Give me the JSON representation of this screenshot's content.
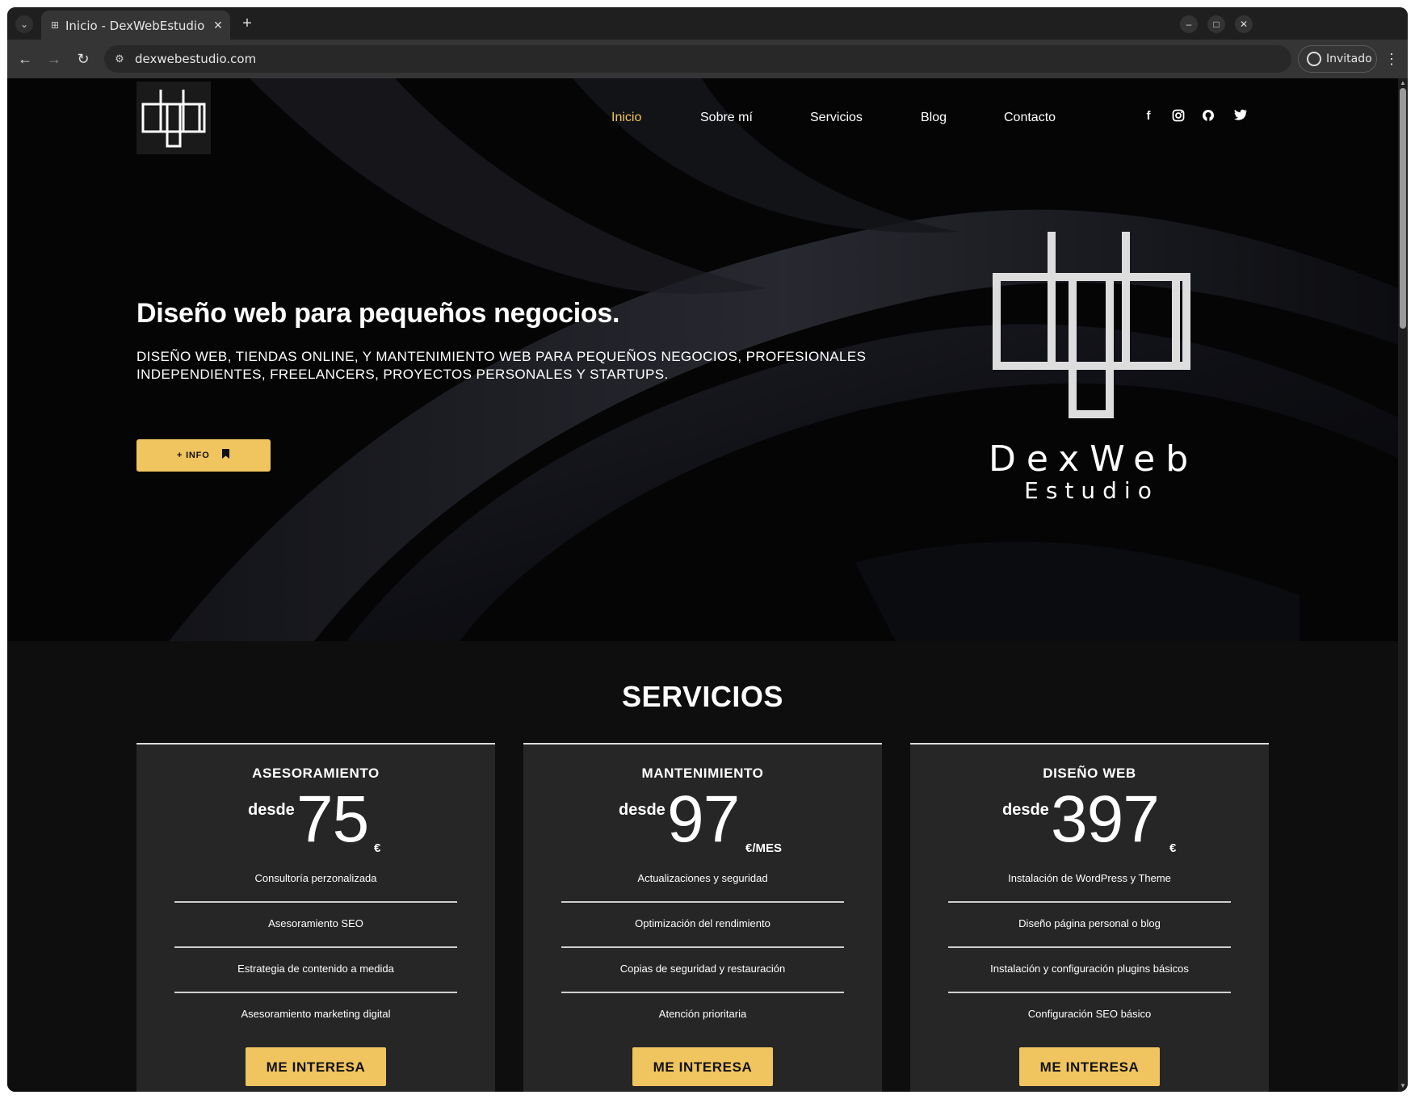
{
  "browser": {
    "tab_title": "Inicio - DexWebEstudio",
    "url": "dexwebestudio.com",
    "profile_label": "Invitado",
    "icons": {
      "tab_menu": "chevron-down-icon",
      "tab_favicon": "site-favicon-icon",
      "tab_close": "close-icon",
      "new_tab": "plus-icon",
      "minimize": "minimize-icon",
      "maximize": "maximize-icon",
      "close_window": "close-icon",
      "back": "back-arrow-icon",
      "forward": "forward-arrow-icon",
      "reload": "reload-icon",
      "site_settings": "tune-icon",
      "profile": "person-icon",
      "menu": "kebab-icon"
    }
  },
  "site": {
    "nav": [
      {
        "label": "Inicio",
        "active": true
      },
      {
        "label": "Sobre mí",
        "active": false
      },
      {
        "label": "Servicios",
        "active": false
      },
      {
        "label": "Blog",
        "active": false
      },
      {
        "label": "Contacto",
        "active": false
      }
    ],
    "social": [
      "facebook-icon",
      "instagram-icon",
      "github-icon",
      "twitter-icon"
    ],
    "hero": {
      "title": "Diseño web para pequeños negocios.",
      "subtitle": "DISEÑO WEB, TIENDAS ONLINE, Y MANTENIMIENTO WEB PARA PEQUEÑOS NEGOCIOS, PROFESIONALES INDEPENDIENTES, FREELANCERS, PROYECTOS PERSONALES Y STARTUPS.",
      "button_label": "+ INFO",
      "button_icon": "bookmark-icon",
      "brand_name": "DexWeb",
      "brand_tagline": "Estudio"
    },
    "services": {
      "title": "SERVICIOS",
      "cards": [
        {
          "name": "ASESORAMIENTO",
          "from": "desde",
          "price": "75",
          "unit": "€",
          "features": [
            "Consultoría perzonalizada",
            "Asesoramiento SEO",
            "Estrategia de contenido a medida",
            "Asesoramiento marketing digital"
          ],
          "cta": "ME INTERESA"
        },
        {
          "name": "MANTENIMIENTO",
          "from": "desde",
          "price": "97",
          "unit": "€/MES",
          "features": [
            "Actualizaciones y seguridad",
            "Optimización del rendimiento",
            "Copias de seguridad y restauración",
            "Atención prioritaria"
          ],
          "cta": "ME INTERESA"
        },
        {
          "name": "DISEÑO WEB",
          "from": "desde",
          "price": "397",
          "unit": "€",
          "features": [
            "Instalación de WordPress y Theme",
            "Diseño página personal o blog",
            "Instalación y configuración plugins básicos",
            "Configuración SEO básico"
          ],
          "cta": "ME INTERESA"
        }
      ]
    }
  },
  "colors": {
    "accent": "#f0c45e",
    "page_bg": "#0e0e0e",
    "card_bg": "#262626"
  }
}
